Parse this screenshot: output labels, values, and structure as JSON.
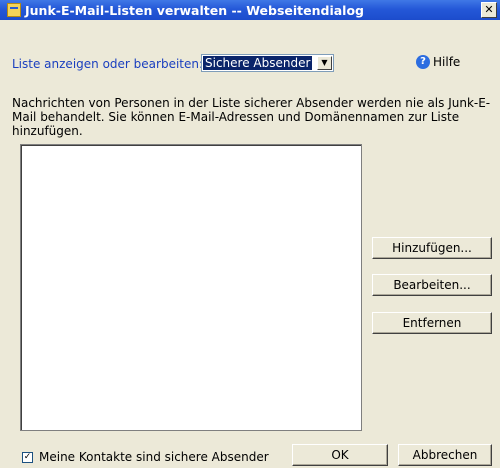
{
  "window": {
    "title": "Junk-E-Mail-Listen verwalten -- Webseitendialog",
    "close_glyph": "✕"
  },
  "list_select": {
    "label": "Liste anzeigen oder bearbeiten:",
    "value": "Sichere Absender",
    "arrow": "▼"
  },
  "help": {
    "icon_glyph": "?",
    "label": "Hilfe"
  },
  "description": "Nachrichten von Personen in der Liste sicherer Absender werden nie als Junk-E-Mail behandelt. Sie können E-Mail-Adressen und Domänennamen zur Liste hinzufügen.",
  "list_items": [],
  "buttons": {
    "add": "Hinzufügen...",
    "edit": "Bearbeiten...",
    "remove": "Entfernen",
    "ok": "OK",
    "cancel": "Abbrechen"
  },
  "contacts_checkbox": {
    "label": "Meine Kontakte sind sichere Absender",
    "checked": true,
    "glyph": "✓"
  }
}
